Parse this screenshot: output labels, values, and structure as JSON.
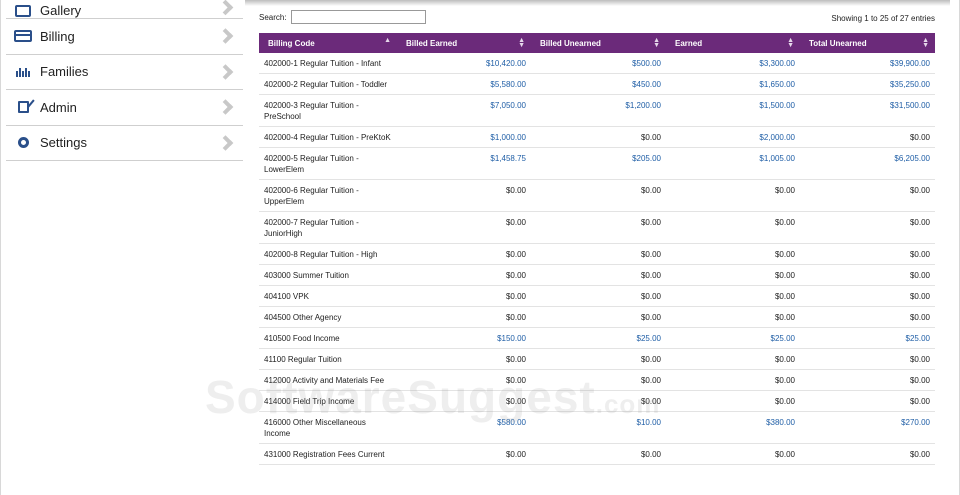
{
  "sidebar": {
    "items": [
      {
        "label": "Gallery",
        "icon": "gallery-icon"
      },
      {
        "label": "Billing",
        "icon": "credit-card-icon"
      },
      {
        "label": "Families",
        "icon": "families-icon"
      },
      {
        "label": "Admin",
        "icon": "admin-edit-icon"
      },
      {
        "label": "Settings",
        "icon": "gear-icon"
      }
    ]
  },
  "search": {
    "label": "Search:",
    "value": ""
  },
  "info": "Showing 1 to 25 of 27 entries",
  "table": {
    "headers": [
      "Billing Code",
      "Billed Earned",
      "Billed Unearned",
      "Earned",
      "Total Unearned"
    ],
    "rows": [
      {
        "code": "402000-1 Regular Tuition - Infant",
        "be": "$10,420.00",
        "bu": "$500.00",
        "e": "$3,300.00",
        "tu": "$39,900.00"
      },
      {
        "code": "402000-2 Regular Tuition - Toddler",
        "be": "$5,580.00",
        "bu": "$450.00",
        "e": "$1,650.00",
        "tu": "$35,250.00"
      },
      {
        "code": "402000-3 Regular Tuition - PreSchool",
        "be": "$7,050.00",
        "bu": "$1,200.00",
        "e": "$1,500.00",
        "tu": "$31,500.00"
      },
      {
        "code": "402000-4 Regular Tuition - PreKtoK",
        "be": "$1,000.00",
        "bu": "$0.00",
        "e": "$2,000.00",
        "tu": "$0.00"
      },
      {
        "code": "402000-5 Regular Tuition - LowerElem",
        "be": "$1,458.75",
        "bu": "$205.00",
        "e": "$1,005.00",
        "tu": "$6,205.00"
      },
      {
        "code": "402000-6 Regular Tuition - UpperElem",
        "be": "$0.00",
        "bu": "$0.00",
        "e": "$0.00",
        "tu": "$0.00"
      },
      {
        "code": "402000-7 Regular Tuition - JuniorHigh",
        "be": "$0.00",
        "bu": "$0.00",
        "e": "$0.00",
        "tu": "$0.00"
      },
      {
        "code": "402000-8 Regular Tuition - High",
        "be": "$0.00",
        "bu": "$0.00",
        "e": "$0.00",
        "tu": "$0.00"
      },
      {
        "code": "403000 Summer Tuition",
        "be": "$0.00",
        "bu": "$0.00",
        "e": "$0.00",
        "tu": "$0.00"
      },
      {
        "code": "404100 VPK",
        "be": "$0.00",
        "bu": "$0.00",
        "e": "$0.00",
        "tu": "$0.00"
      },
      {
        "code": "404500 Other Agency",
        "be": "$0.00",
        "bu": "$0.00",
        "e": "$0.00",
        "tu": "$0.00"
      },
      {
        "code": "410500 Food Income",
        "be": "$150.00",
        "bu": "$25.00",
        "e": "$25.00",
        "tu": "$25.00"
      },
      {
        "code": "41100 Regular Tuition",
        "be": "$0.00",
        "bu": "$0.00",
        "e": "$0.00",
        "tu": "$0.00"
      },
      {
        "code": "412000 Activity and Materials Fee",
        "be": "$0.00",
        "bu": "$0.00",
        "e": "$0.00",
        "tu": "$0.00"
      },
      {
        "code": "414000 Field Trip Income",
        "be": "$0.00",
        "bu": "$0.00",
        "e": "$0.00",
        "tu": "$0.00"
      },
      {
        "code": "416000 Other Miscellaneous Income",
        "be": "$580.00",
        "bu": "$10.00",
        "e": "$380.00",
        "tu": "$270.00"
      },
      {
        "code": "431000 Registration Fees Current",
        "be": "$0.00",
        "bu": "$0.00",
        "e": "$0.00",
        "tu": "$0.00"
      }
    ]
  },
  "watermark": {
    "main": "SoftwareSuggest",
    "suffix": ".com"
  },
  "colors": {
    "header_bg": "#6b2a7a",
    "link_blue": "#1f5ea6",
    "icon_blue": "#2a4f8a"
  }
}
